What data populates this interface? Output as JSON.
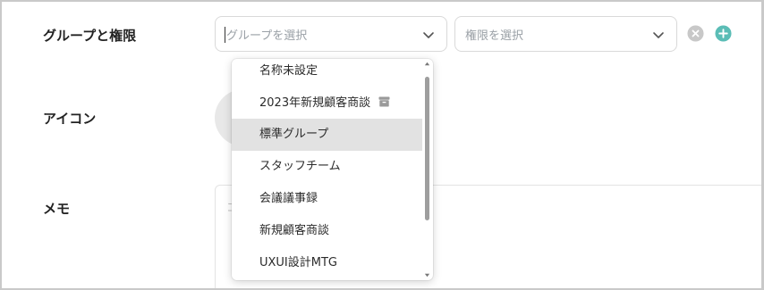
{
  "fields": {
    "group_label": "グループと権限",
    "icon_label": "アイコン",
    "memo_label": "メモ",
    "memo_placeholder": "コ"
  },
  "group_select": {
    "placeholder": "グループを選択",
    "icon": "chevron-down-icon"
  },
  "permission_select": {
    "placeholder": "権限を選択",
    "icon": "chevron-down-icon"
  },
  "buttons": {
    "clear": {
      "icon": "close-circle-icon",
      "color": "#c8c8c8"
    },
    "add": {
      "icon": "plus-circle-icon",
      "color": "#5bbdb6"
    }
  },
  "dropdown": {
    "options": [
      {
        "label": "名称未設定",
        "archived": false,
        "highlighted": false
      },
      {
        "label": "2023年新規顧客商談",
        "archived": true,
        "highlighted": false
      },
      {
        "label": "標準グループ",
        "archived": false,
        "highlighted": true
      },
      {
        "label": "スタッフチーム",
        "archived": false,
        "highlighted": false
      },
      {
        "label": "会議議事録",
        "archived": false,
        "highlighted": false
      },
      {
        "label": "新規顧客商談",
        "archived": false,
        "highlighted": false
      },
      {
        "label": "UXUI設計MTG",
        "archived": false,
        "highlighted": false
      }
    ],
    "archive_icon": "archive-box-icon"
  },
  "colors": {
    "highlight": "#e2e2e2",
    "accent": "#5bbdb6",
    "scrollbar": "#9e9e9e"
  }
}
